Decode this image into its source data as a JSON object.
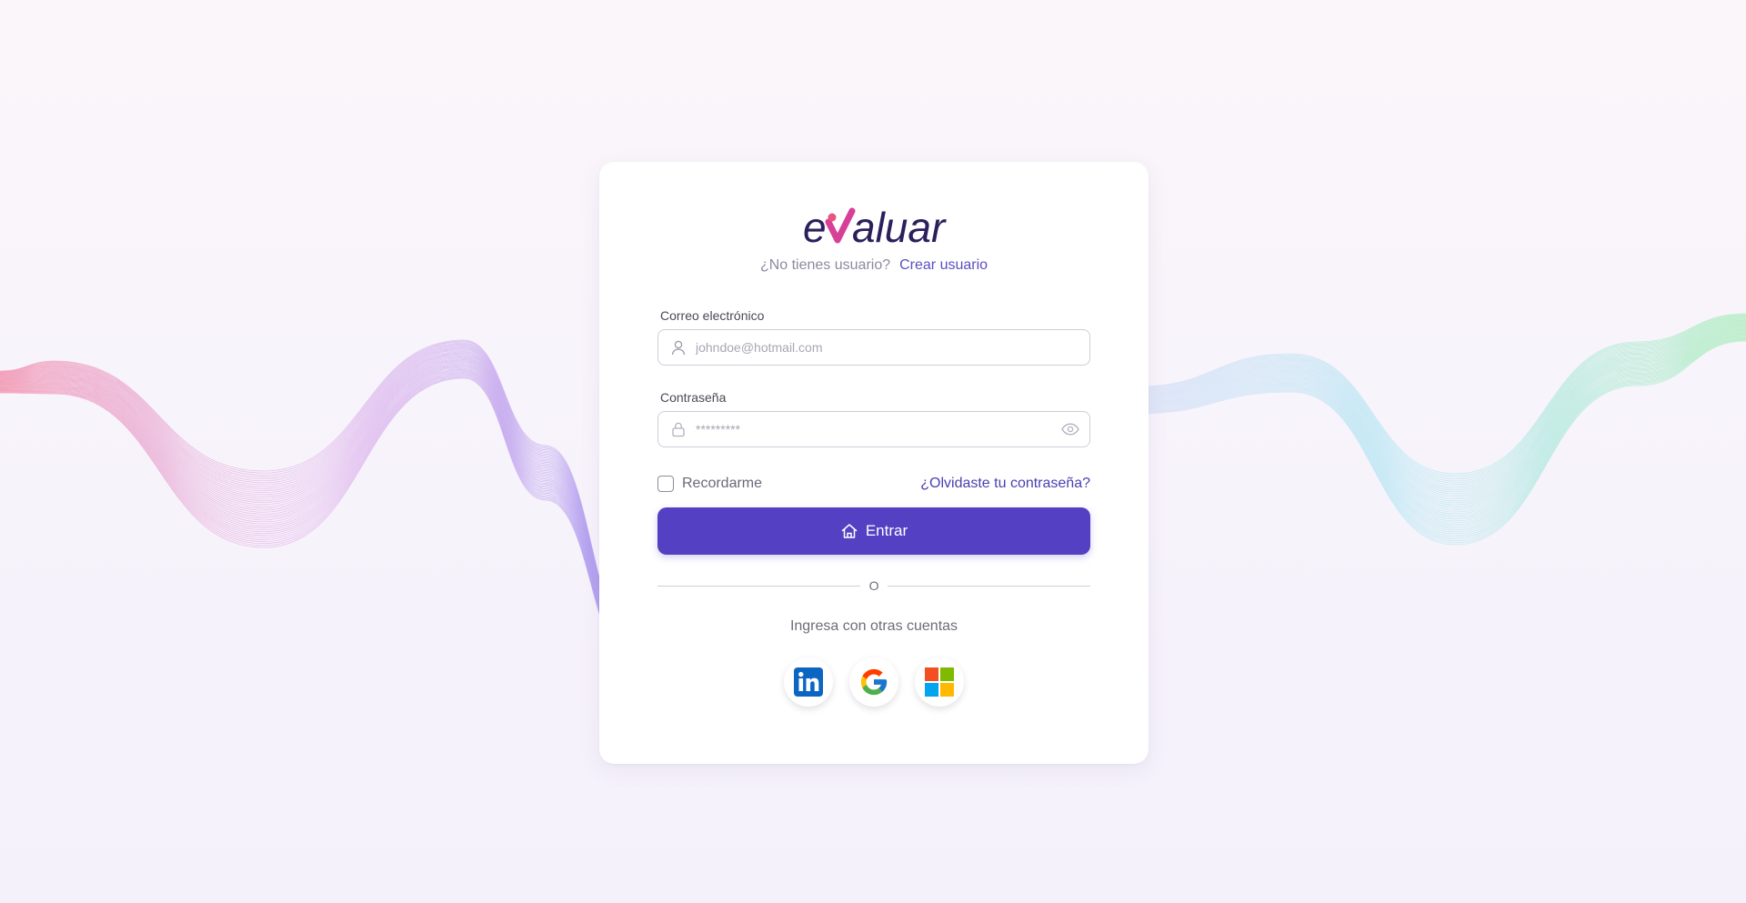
{
  "brand": {
    "name": "evaluar",
    "primary_color": "#5340c2",
    "text_color": "#2b1f5c",
    "accent_colors": [
      "#e24c8c",
      "#d23fa3"
    ]
  },
  "signup": {
    "prompt": "¿No tienes usuario?",
    "link_label": "Crear usuario"
  },
  "email": {
    "label": "Correo electrónico",
    "placeholder": "johndoe@hotmail.com",
    "value": "",
    "icon": "user-icon"
  },
  "password": {
    "label": "Contraseña",
    "placeholder": "*********",
    "value": "",
    "icon": "lock-icon",
    "toggle_icon": "eye-icon"
  },
  "remember": {
    "label": "Recordarme",
    "checked": false
  },
  "forgot": {
    "label": "¿Olvidaste tu contraseña?"
  },
  "submit": {
    "label": "Entrar",
    "icon": "home-icon"
  },
  "divider": {
    "label": "O"
  },
  "alternative": {
    "label": "Ingresa con otras cuentas",
    "providers": [
      {
        "name": "LinkedIn",
        "icon": "linkedin-icon",
        "color": "#0a66c2"
      },
      {
        "name": "Google",
        "icon": "google-icon",
        "color": "#4285f4"
      },
      {
        "name": "Microsoft",
        "icon": "microsoft-icon",
        "color": "#f25022"
      }
    ]
  }
}
